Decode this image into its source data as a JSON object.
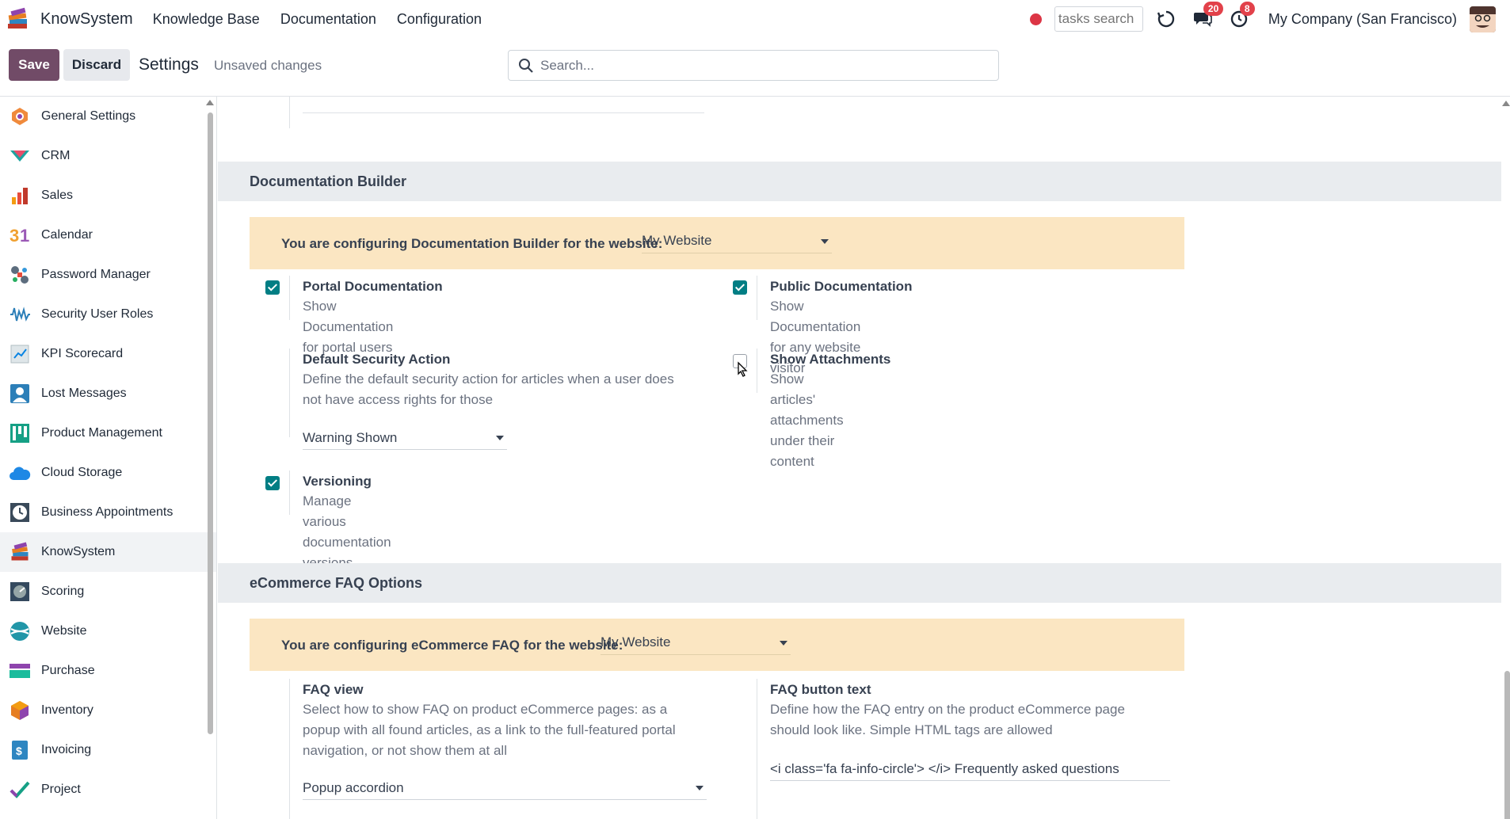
{
  "navbar": {
    "app_name": "KnowSystem",
    "menu": [
      "Knowledge Base",
      "Documentation",
      "Configuration"
    ],
    "tasks_search_placeholder": "tasks search",
    "messages_badge": "20",
    "activities_badge": "8",
    "company": "My Company (San Francisco)"
  },
  "control_panel": {
    "save_label": "Save",
    "discard_label": "Discard",
    "title": "Settings",
    "status": "Unsaved changes",
    "search_placeholder": "Search..."
  },
  "sidebar": {
    "items": [
      {
        "label": "General Settings",
        "icon": "general-settings-icon"
      },
      {
        "label": "CRM",
        "icon": "crm-icon"
      },
      {
        "label": "Sales",
        "icon": "sales-icon"
      },
      {
        "label": "Calendar",
        "icon": "calendar-icon"
      },
      {
        "label": "Password Manager",
        "icon": "password-manager-icon"
      },
      {
        "label": "Security User Roles",
        "icon": "security-user-roles-icon"
      },
      {
        "label": "KPI Scorecard",
        "icon": "kpi-scorecard-icon"
      },
      {
        "label": "Lost Messages",
        "icon": "lost-messages-icon"
      },
      {
        "label": "Product Management",
        "icon": "product-management-icon"
      },
      {
        "label": "Cloud Storage",
        "icon": "cloud-storage-icon"
      },
      {
        "label": "Business Appointments",
        "icon": "business-appointments-icon"
      },
      {
        "label": "KnowSystem",
        "icon": "knowsystem-icon",
        "active": true
      },
      {
        "label": "Scoring",
        "icon": "scoring-icon"
      },
      {
        "label": "Website",
        "icon": "website-icon"
      },
      {
        "label": "Purchase",
        "icon": "purchase-icon"
      },
      {
        "label": "Inventory",
        "icon": "inventory-icon"
      },
      {
        "label": "Invoicing",
        "icon": "invoicing-icon"
      },
      {
        "label": "Project",
        "icon": "project-icon"
      }
    ]
  },
  "documentation_builder": {
    "heading": "Documentation Builder",
    "alert_text": "You are configuring Documentation Builder for the website:",
    "website": "My Website",
    "portal_documentation": {
      "title": "Portal Documentation",
      "desc": "Show Documentation for portal users",
      "checked": true
    },
    "public_documentation": {
      "title": "Public Documentation",
      "desc": "Show Documentation for any website visitor",
      "checked": true
    },
    "default_security_action": {
      "title": "Default Security Action",
      "desc_line1": "Define the default security action for articles when a user does",
      "desc_line2": "not have access rights for those",
      "value": "Warning Shown"
    },
    "show_attachments": {
      "title": "Show Attachments",
      "desc": "Show articles' attachments under their content",
      "checked": false
    },
    "versioning": {
      "title": "Versioning",
      "desc": "Manage various documentation versions",
      "checked": true
    }
  },
  "ecommerce_faq": {
    "heading": "eCommerce FAQ Options",
    "alert_text": "You are configuring eCommerce FAQ for the website:",
    "website": "My Website",
    "faq_view": {
      "title": "FAQ view",
      "desc_line1": "Select how to show FAQ on product eCommerce pages: as a",
      "desc_line2": "popup with all found articles, as a link to the full-featured portal",
      "desc_line3": "navigation, or not show them at all",
      "value": "Popup accordion"
    },
    "faq_button_text": {
      "title": "FAQ button text",
      "desc_line1": "Define how the FAQ entry on the product eCommerce page",
      "desc_line2": "should look like. Simple HTML tags are allowed",
      "value": "<i class='fa fa-info-circle'> </i> Frequently asked questions"
    }
  },
  "colors": {
    "brand": "#714B67",
    "accent": "#017e84",
    "alert_bg": "#fbe6c2",
    "badge": "#e2414a"
  }
}
